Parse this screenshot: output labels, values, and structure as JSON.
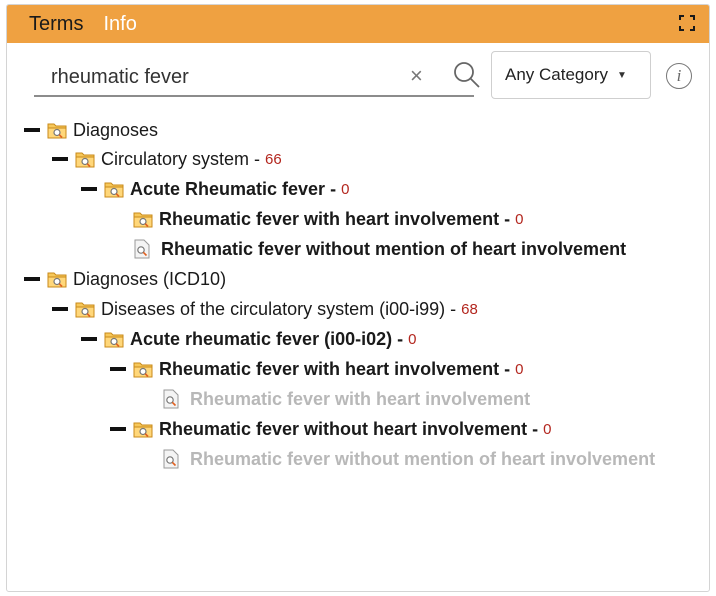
{
  "header": {
    "tab_terms": "Terms",
    "tab_info": "Info",
    "accent_color": "#efa141"
  },
  "search": {
    "value": "rheumatic fever",
    "clear_glyph": "×",
    "category": "Any Category",
    "info_glyph": "i"
  },
  "tree": {
    "n0": {
      "label": "Diagnoses"
    },
    "n1": {
      "label": "Circulatory system",
      "sep": "-",
      "count": "66"
    },
    "n2": {
      "label": "Acute Rheumatic fever",
      "sep": "-",
      "count": "0"
    },
    "n3": {
      "label": "Rheumatic fever with heart involvement",
      "sep": "-",
      "count": "0"
    },
    "n4": {
      "label": "Rheumatic fever without mention of heart involvement"
    },
    "n5": {
      "label": "Diagnoses (ICD10)"
    },
    "n6": {
      "label": "Diseases of the circulatory system (i00-i99)",
      "sep": "-",
      "count": "68"
    },
    "n7": {
      "label": "Acute rheumatic fever (i00-i02)",
      "sep": "-",
      "count": "0"
    },
    "n8": {
      "label": "Rheumatic fever with heart involvement",
      "sep": "-",
      "count": "0"
    },
    "n9": {
      "label": "Rheumatic fever with heart involvement"
    },
    "n10": {
      "label": "Rheumatic fever without heart involvement",
      "sep": "-",
      "count": "0"
    },
    "n11": {
      "label": "Rheumatic fever without mention of heart involvement"
    }
  },
  "icons": {
    "folder": "folder-search-icon",
    "document": "document-search-icon",
    "collapse": "collapse-icon"
  }
}
